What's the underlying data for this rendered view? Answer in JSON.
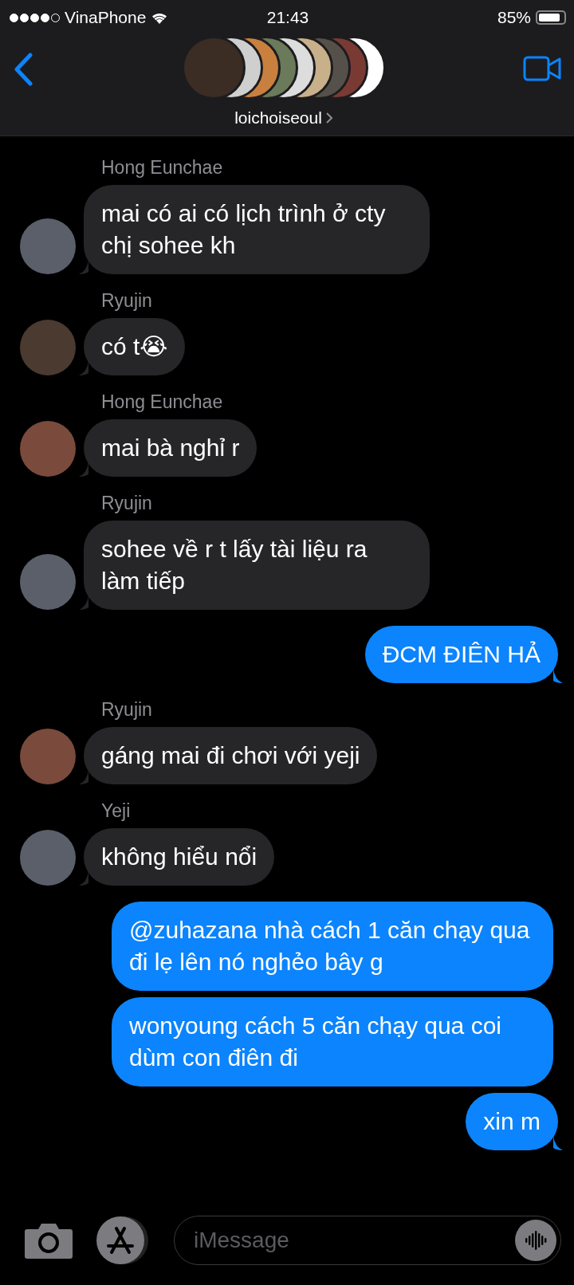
{
  "status_bar": {
    "carrier": "VinaPhone",
    "time": "21:43",
    "battery": "85%"
  },
  "header": {
    "group_name": "loichoiseoul"
  },
  "messages": [
    {
      "kind": "incoming",
      "sender": "Hong Eunchae",
      "text": "mai có ai có lịch trình ở cty chị sohee kh"
    },
    {
      "kind": "incoming",
      "sender": "Ryujin",
      "text": "có t😭"
    },
    {
      "kind": "incoming",
      "sender": "Hong Eunchae",
      "text": "mai bà nghỉ r"
    },
    {
      "kind": "incoming",
      "sender": "Ryujin",
      "text": "sohee về r t lấy tài liệu ra làm tiếp"
    },
    {
      "kind": "outgoing",
      "text": "ĐCM ĐIÊN HẢ",
      "tail": true
    },
    {
      "kind": "incoming",
      "sender": "Ryujin",
      "text": "gáng mai đi chơi với yeji"
    },
    {
      "kind": "incoming",
      "sender": "Yeji",
      "text": "không hiểu nổi"
    },
    {
      "kind": "outgoing",
      "text": "@zuhazana nhà cách 1 căn chạy qua đi lẹ lên nó nghẻo bây g",
      "tail": false
    },
    {
      "kind": "outgoing",
      "text": "wonyoung cách 5 căn chạy qua coi dùm con điên đi",
      "tail": false
    },
    {
      "kind": "outgoing",
      "text": "xin m",
      "tail": true
    }
  ],
  "composer": {
    "placeholder": "iMessage"
  }
}
